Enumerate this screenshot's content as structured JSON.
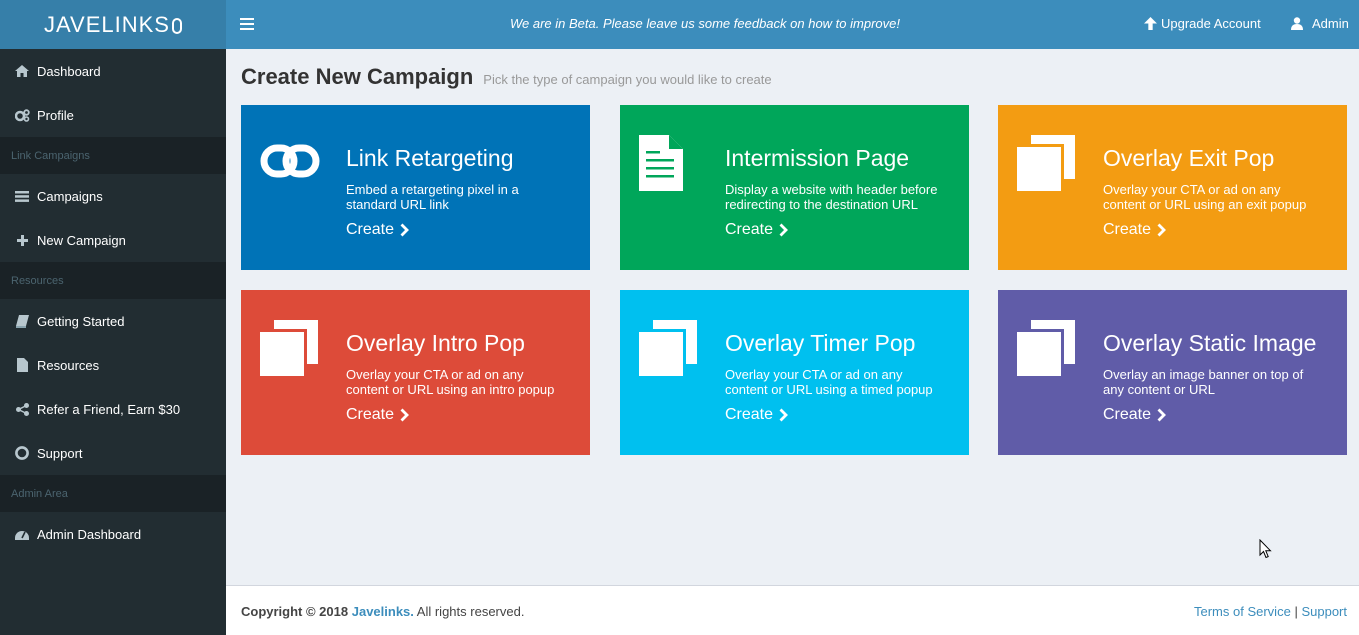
{
  "app": {
    "logo_text": "JAVELINKS"
  },
  "topbar": {
    "beta_message": "We are in Beta. Please leave us some feedback on how to improve!",
    "upgrade_label": "Upgrade Account",
    "admin_label": "Admin"
  },
  "sidebar": {
    "dashboard": "Dashboard",
    "profile": "Profile",
    "header_link_campaigns": "Link Campaigns",
    "campaigns": "Campaigns",
    "new_campaign": "New Campaign",
    "header_resources": "Resources",
    "getting_started": "Getting Started",
    "resources": "Resources",
    "refer": "Refer a Friend, Earn $30",
    "support": "Support",
    "header_admin": "Admin Area",
    "admin_dashboard": "Admin Dashboard"
  },
  "main": {
    "title": "Create New Campaign",
    "subtitle": "Pick the type of campaign you would like to create",
    "create_label": "Create",
    "tiles": [
      {
        "title": "Link Retargeting",
        "desc": "Embed a retargeting pixel in a standard URL link",
        "color": "#0073b7",
        "icon": "link-icon"
      },
      {
        "title": "Intermission Page",
        "desc": "Display a website with header before redirecting to the destination URL",
        "color": "#00a65a",
        "icon": "file-text-icon"
      },
      {
        "title": "Overlay Exit Pop",
        "desc": "Overlay your CTA or ad on any content or URL using an exit popup",
        "color": "#f39c12",
        "icon": "clone-icon"
      },
      {
        "title": "Overlay Intro Pop",
        "desc": "Overlay your CTA or ad on any content or URL using an intro popup",
        "color": "#dd4b39",
        "icon": "clone-icon"
      },
      {
        "title": "Overlay Timer Pop",
        "desc": "Overlay your CTA or ad on any content or URL using a timed popup",
        "color": "#00c0ef",
        "icon": "clone-icon"
      },
      {
        "title": "Overlay Static Image",
        "desc": "Overlay an image banner on top of any content or URL",
        "color": "#605ca8",
        "icon": "clone-icon"
      }
    ]
  },
  "footer": {
    "copyright_prefix": "Copyright © 2018",
    "brand": "Javelinks.",
    "rights": "All rights reserved.",
    "terms": "Terms of Service",
    "separator": "|",
    "support": "Support"
  }
}
